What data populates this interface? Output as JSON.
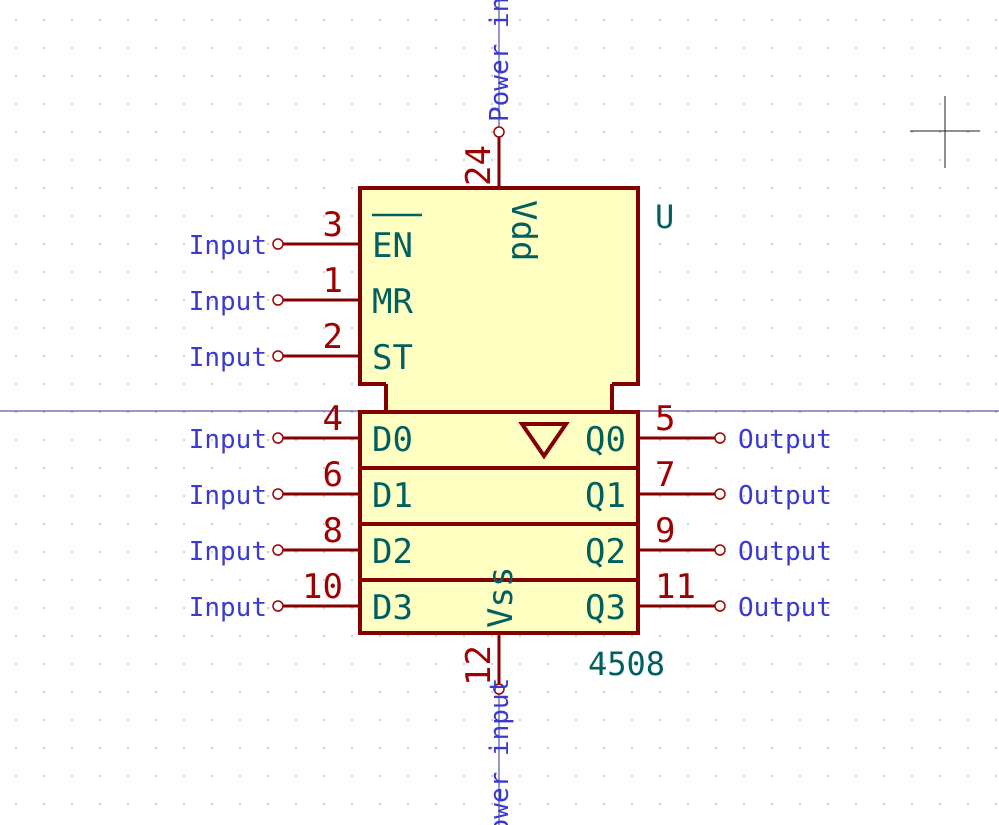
{
  "component": {
    "reference": "U",
    "value": "4508"
  },
  "power_pins": [
    {
      "id": "vdd",
      "number": "24",
      "name": "Vdd",
      "electrical_type": "Power input"
    },
    {
      "id": "vss",
      "number": "12",
      "name": "Vss",
      "electrical_type": "Power input"
    }
  ],
  "left_pins": [
    {
      "id": "en",
      "number": "3",
      "name": "EN",
      "name_overbar": true,
      "electrical_type": "Input"
    },
    {
      "id": "mr",
      "number": "1",
      "name": "MR",
      "electrical_type": "Input"
    },
    {
      "id": "st",
      "number": "2",
      "name": "ST",
      "electrical_type": "Input"
    },
    {
      "id": "d0",
      "number": "4",
      "name": "D0",
      "electrical_type": "Input"
    },
    {
      "id": "d1",
      "number": "6",
      "name": "D1",
      "electrical_type": "Input"
    },
    {
      "id": "d2",
      "number": "8",
      "name": "D2",
      "electrical_type": "Input"
    },
    {
      "id": "d3",
      "number": "10",
      "name": "D3",
      "electrical_type": "Input"
    }
  ],
  "right_pins": [
    {
      "id": "q0",
      "number": "5",
      "name": "Q0",
      "electrical_type": "Output"
    },
    {
      "id": "q1",
      "number": "7",
      "name": "Q1",
      "electrical_type": "Output"
    },
    {
      "id": "q2",
      "number": "9",
      "name": "Q2",
      "electrical_type": "Output"
    },
    {
      "id": "q3",
      "number": "11",
      "name": "Q3",
      "electrical_type": "Output"
    }
  ],
  "colors": {
    "body_fill": "#ffffc2",
    "body_stroke": "#840000",
    "pin_line": "#840000",
    "pin_number": "#a00000",
    "pin_name": "#006060",
    "electrical_type": "#3a3ad0",
    "grid_dot": "#b0b0b0",
    "crosshair": "#3030a0",
    "cursor": "#202020"
  }
}
